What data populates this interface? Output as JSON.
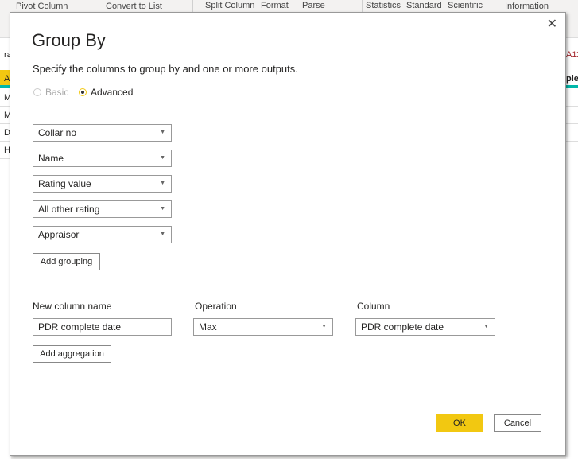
{
  "ribbon": {
    "items": [
      "Pivot Column",
      "Convert to List",
      "Split Column",
      "Format",
      "Parse",
      "Statistics",
      "Standard",
      "Scientific",
      "Information"
    ]
  },
  "background_grid": {
    "left_header": "A",
    "left_rows": [
      "M",
      "M",
      "D",
      "H"
    ],
    "left_top": "ra",
    "right_top": "A11",
    "right_header": "ple"
  },
  "dialog": {
    "title": "Group By",
    "close_icon": "close-icon",
    "description": "Specify the columns to group by and one or more outputs.",
    "mode_options": [
      {
        "label": "Basic",
        "selected": false,
        "enabled": false
      },
      {
        "label": "Advanced",
        "selected": true,
        "enabled": true
      }
    ],
    "groupings": [
      "Collar no",
      "Name",
      "Rating value",
      "All other rating",
      "Appraisor"
    ],
    "add_grouping_label": "Add grouping",
    "headers": {
      "new_column_name": "New column name",
      "operation": "Operation",
      "column": "Column"
    },
    "aggregation": {
      "new_column_name": "PDR complete date",
      "operation": "Max",
      "column": "PDR complete date"
    },
    "add_aggregation_label": "Add aggregation",
    "ok_label": "OK",
    "cancel_label": "Cancel",
    "accent_color": "#f2c811"
  }
}
